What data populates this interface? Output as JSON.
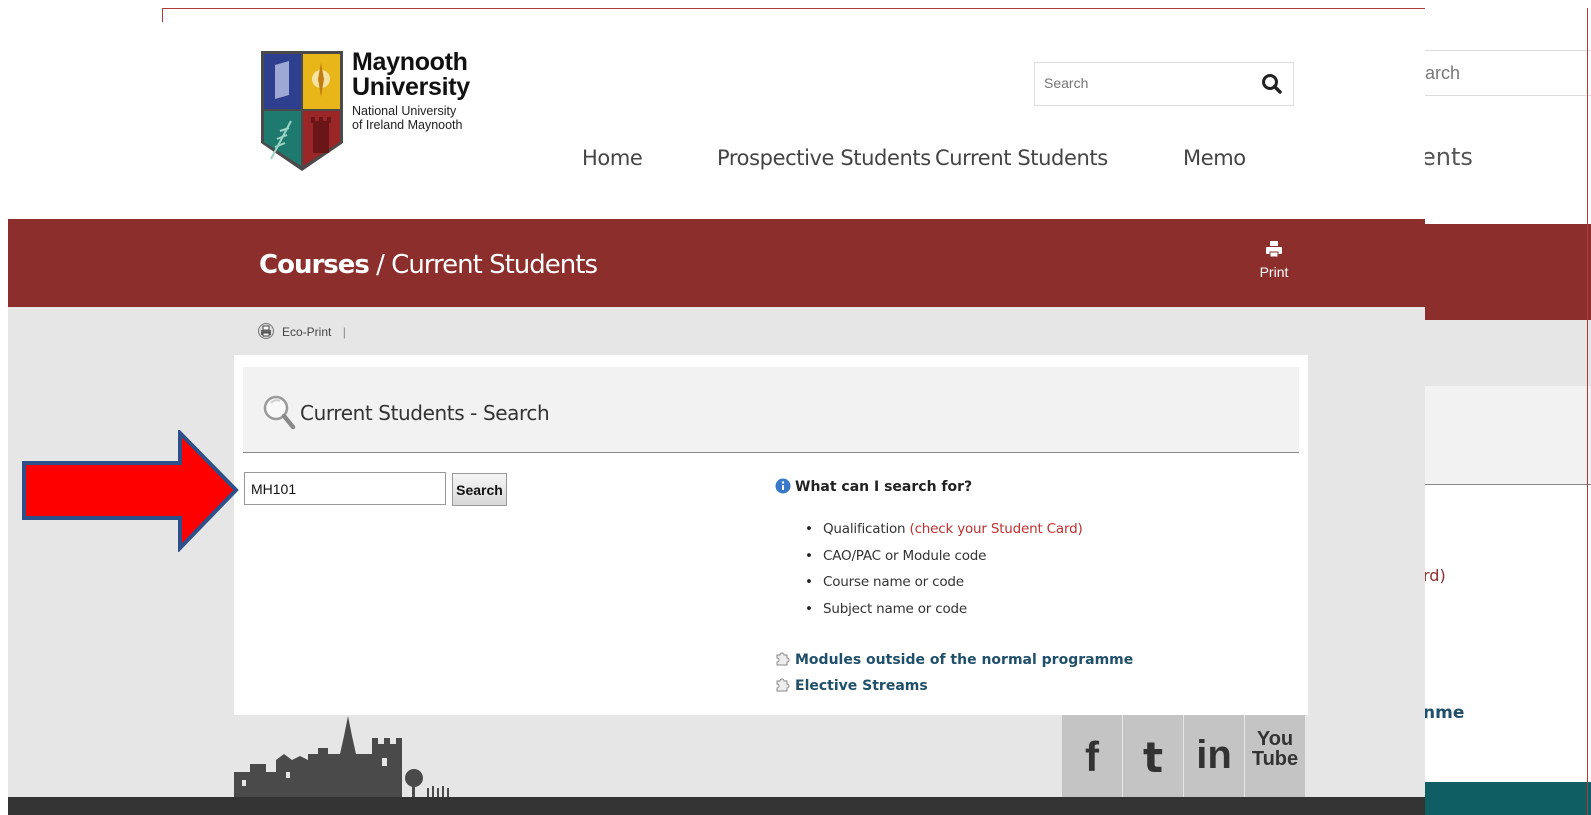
{
  "header": {
    "logo": {
      "name_line1": "Maynooth",
      "name_line2": "University",
      "sub_line1": "National University",
      "sub_line2": "of Ireland Maynooth"
    },
    "search_placeholder": "Search",
    "nav": [
      "Home",
      "Prospective Students",
      "Current Students",
      "Memo"
    ]
  },
  "band": {
    "crumb_bold": "Courses",
    "crumb_sep": " / ",
    "crumb_rest": "Current Students",
    "print_label": "Print"
  },
  "toolbar": {
    "eco_print": "Eco-Print",
    "separator": "|"
  },
  "panel": {
    "title": "Current Students - Search",
    "input_value": "MH101",
    "search_button": "Search",
    "help_title": "What can I search for?",
    "help_items": [
      {
        "text": "Qualification ",
        "note": "(check your Student Card)"
      },
      {
        "text": "CAO/PAC or Module code"
      },
      {
        "text": "Course name or code"
      },
      {
        "text": "Subject name or code"
      }
    ],
    "links": [
      "Modules outside of the normal programme",
      "Elective Streams"
    ]
  },
  "social": {
    "facebook": "f",
    "twitter": "t",
    "linkedin": "in",
    "youtube_line1": "You",
    "youtube_line2": "Tube"
  },
  "ghost": {
    "search": "earch",
    "nav_fragment": "ents",
    "red_fragment": "rd)",
    "link_fragment": "nme"
  },
  "colors": {
    "maroon": "#8b2e2c",
    "link": "#1f4f6a",
    "note_red": "#c03030",
    "arrow_red": "#ff0000",
    "arrow_border": "#2d4f8a"
  }
}
